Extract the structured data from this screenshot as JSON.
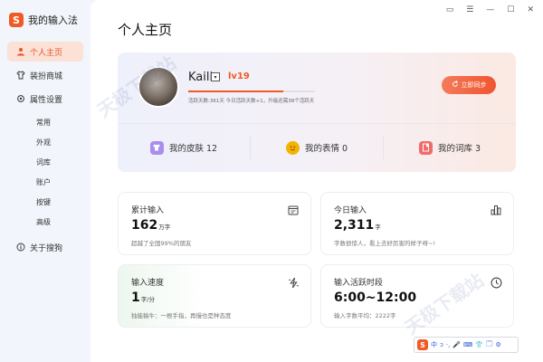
{
  "app": {
    "title": "我的输入法",
    "logo_letter": "S"
  },
  "sidebar": {
    "items": [
      {
        "label": "个人主页",
        "icon": "person-icon",
        "active": true
      },
      {
        "label": "装扮商城",
        "icon": "shirt-icon",
        "active": false
      },
      {
        "label": "属性设置",
        "icon": "settings-icon",
        "active": false
      }
    ],
    "sub_items": [
      "常用",
      "外观",
      "词库",
      "账户",
      "按键",
      "高级"
    ],
    "about": {
      "label": "关于搜狗",
      "icon": "info-icon"
    }
  },
  "window_controls": {
    "feedback": "▭",
    "menu": "☰",
    "minimize": "—",
    "maximize": "☐",
    "close": "✕"
  },
  "page": {
    "title": "个人主页"
  },
  "profile": {
    "username": "Kaili",
    "dropdown": "▾",
    "level": "lv19",
    "progress_fraction": 0.75,
    "active_text": "活跃天数:361天 今日活跃天数+1，升级还需38个活跃天",
    "sync_label": "立即同步",
    "sync_icon": "sync-icon"
  },
  "stats": [
    {
      "label": "我的皮肤 12",
      "icon": "skin-icon",
      "color": "#a98df0"
    },
    {
      "label": "我的表情 0",
      "icon": "emoji-icon",
      "color": "#f5b300"
    },
    {
      "label": "我的词库 3",
      "icon": "book-icon",
      "color": "#f26b6b"
    }
  ],
  "info": {
    "total": {
      "title": "累计输入",
      "value": "162",
      "unit": "万字",
      "sub": "超越了全国99%的朋友",
      "icon": "calendar-icon"
    },
    "today": {
      "title": "今日输入",
      "value": "2,311",
      "unit": "字",
      "sub": "字数很惊人，看上去好厉害的样子呀~!",
      "icon": "chart-icon"
    },
    "speed": {
      "title": "输入速度",
      "value": "1",
      "unit": "字/分",
      "sub": "独能稿牛：一根手指，再慢也是种态度",
      "icon": "lightning-icon"
    },
    "period": {
      "title": "输入活跃时段",
      "value": "6:00~12:00",
      "unit": "",
      "sub": "输入字数平均：2222字",
      "icon": "clock-icon"
    }
  },
  "watermark": "天极下载站",
  "ime_bar": {
    "logo": "S",
    "items": [
      "中",
      "ɔ",
      "·,",
      "🎤",
      "⌨",
      "👕",
      "🗔",
      "⚙"
    ]
  },
  "colors": {
    "accent": "#f05a24",
    "sidebar_bg": "#f2f5fb",
    "active_bg": "#fbe1d6"
  }
}
